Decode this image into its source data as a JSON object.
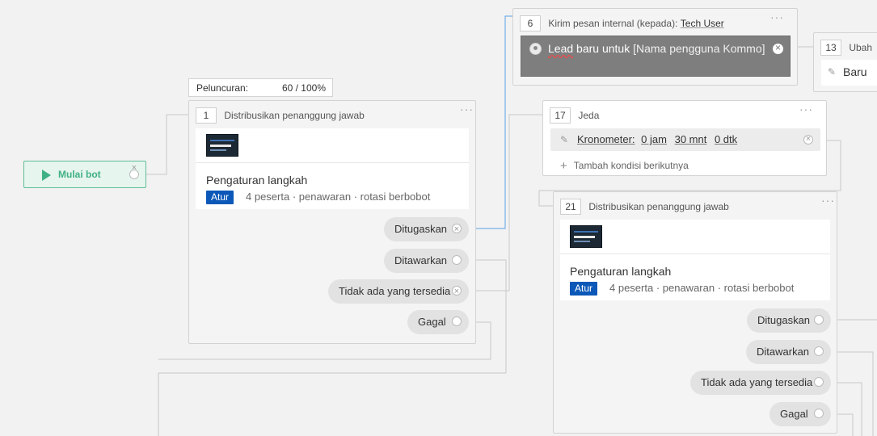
{
  "start": {
    "label": "Mulai bot"
  },
  "launch": {
    "label": "Peluncuran:",
    "value": "60 / 100%"
  },
  "node1": {
    "number": "1",
    "title": "Distribusikan penanggung jawab",
    "menu": "···",
    "step_title": "Pengaturan langkah",
    "button": "Atur",
    "meta": "4 peserta · penawaran · rotasi berbobot",
    "outputs": [
      "Ditugaskan",
      "Ditawarkan",
      "Tidak ada yang tersedia",
      "Gagal"
    ]
  },
  "node6": {
    "number": "6",
    "title_prefix": "Kirim pesan internal (kepada):",
    "title_link": "Tech User",
    "menu": "···",
    "message_lead": "Lead",
    "message_rest": " baru untuk ",
    "message_placeholder": "[Nama pengguna Kommo]"
  },
  "node13": {
    "number": "13",
    "title": "Ubah",
    "content": "Baru"
  },
  "node17": {
    "number": "17",
    "title": "Jeda",
    "menu": "···",
    "cond_label": "Kronometer:",
    "cond_hours": "0 jam",
    "cond_minutes": "30 mnt",
    "cond_seconds": "0 dtk",
    "add_condition": "Tambah kondisi berikutnya"
  },
  "node21": {
    "number": "21",
    "title": "Distribusikan penanggung jawab",
    "menu": "···",
    "step_title": "Pengaturan langkah",
    "button": "Atur",
    "meta": "4 peserta · penawaran · rotasi berbobot",
    "outputs": [
      "Ditugaskan",
      "Ditawarkan",
      "Tidak ada yang tersedia",
      "Gagal"
    ]
  },
  "colors": {
    "accent_blue": "#0b58b8",
    "start_green": "#3fb184",
    "wire_active": "#5aa0e6"
  },
  "icons": [
    "play-icon",
    "pencil-icon",
    "plus-icon",
    "user-avatar-icon",
    "close-icon",
    "more-dots-icon"
  ]
}
